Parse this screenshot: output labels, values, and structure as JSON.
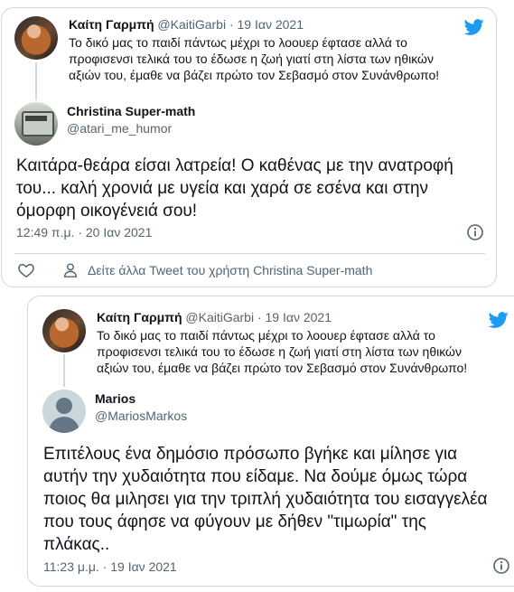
{
  "colors": {
    "twitter_blue": "#1d9bf0",
    "text": "#0f1419",
    "muted": "#536471",
    "border": "#cfd9de"
  },
  "tweet1": {
    "quoted": {
      "name": "Καίτη Γαρμπή",
      "handle": "@KaitiGarbi",
      "date": "· 19 Ιαν 2021",
      "text_lines": [
        "Το δικό μας το παιδί πάντως μέχρι το λοουερ έφτασε αλλά το",
        "προφισενσι τελικά του το έδωσε η ζωή γιατί στη λίστα των ηθικών",
        "αξιών του, έμαθε να βάζει πρώτο τον Σεβασμό στον Συνάνθρωπο!"
      ]
    },
    "reply": {
      "name": "Christina Super-math",
      "handle": "@atari_me_humor",
      "text_lines": [
        "Καιτάρα-θεάρα είσαι λατρεία! Ο καθένας με την ανατροφή",
        "του...  καλή χρονιά με υγεία και χαρά σε εσένα και στην",
        "όμορφη οικογένειά σου!"
      ],
      "timestamp": "12:49 π.μ. · 20 Ιαν 2021"
    },
    "more_tweets_label": "Δείτε άλλα Tweet του χρήστη Christina Super-math",
    "icons": {
      "brand": "twitter-bird-icon",
      "info": "info-icon",
      "like": "heart-icon",
      "profile": "person-icon"
    }
  },
  "tweet2": {
    "quoted": {
      "name": "Καίτη Γαρμπή",
      "handle": "@KaitiGarbi",
      "date": "· 19 Ιαν 2021",
      "text_lines": [
        "Το δικό μας το παιδί πάντως μέχρι το λοουερ έφτασε αλλά το",
        "προφισενσι τελικά του το έδωσε η ζωή γιατί στη λίστα των ηθικών",
        "αξιών του, έμαθε να βάζει πρώτο τον Σεβασμό στον Συνάνθρωπο!"
      ]
    },
    "reply": {
      "name": "Marios",
      "handle": "@MariosMarkos",
      "text_lines": [
        "Επιτέλους ένα δημόσιο πρόσωπο βγήκε και μίλησε για",
        "αυτήν την χυδαιότητα που είδαμε.  Να δούμε όμως τώρα",
        "ποιος θα μιλησει για την τριπλή χυδαιότητα του εισαγγελέα",
        "που τους άφησε να φύγουν με δήθεν \"τιμωρία\"  της",
        "πλάκας.."
      ],
      "timestamp": "11:23 μ.μ. · 19 Ιαν 2021"
    }
  }
}
